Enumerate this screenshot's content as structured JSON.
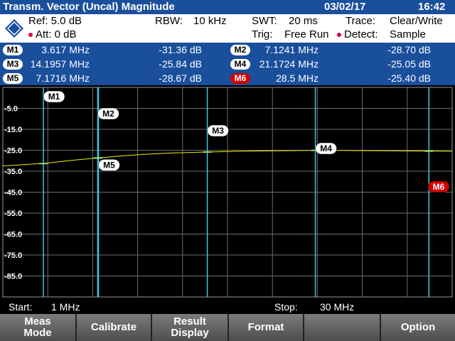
{
  "title": "Transm. Vector (Uncal) Magnitude",
  "date": "03/02/17",
  "time": "16:42",
  "info": {
    "ref": "Ref:  5.0 dB",
    "att": "Att:  0 dB",
    "rbw_label": "RBW:",
    "rbw_value": "10 kHz",
    "swt_label": "SWT:",
    "swt_value": "20 ms",
    "trig_label": "Trig:",
    "trig_value": "Free Run",
    "trace_label": "Trace:",
    "trace_value": "Clear/Write",
    "detect_label": "Detect:",
    "detect_value": "Sample",
    "status_dot_color": "#e0003c"
  },
  "markers": [
    {
      "label": "M1",
      "freq": "3.617 MHz",
      "level": "-31.36 dB",
      "x_mhz": 3.617
    },
    {
      "label": "M2",
      "freq": "7.1241 MHz",
      "level": "-28.70 dB",
      "x_mhz": 7.1241
    },
    {
      "label": "M3",
      "freq": "14.1957 MHz",
      "level": "-25.84 dB",
      "x_mhz": 14.1957
    },
    {
      "label": "M4",
      "freq": "21.1724 MHz",
      "level": "-25.05 dB",
      "x_mhz": 21.1724
    },
    {
      "label": "M5",
      "freq": "7.1716 MHz",
      "level": "-28.67 dB",
      "x_mhz": 7.1716
    },
    {
      "label": "M6",
      "freq": "28.5 MHz",
      "level": "-25.40 dB",
      "x_mhz": 28.5,
      "active": true
    }
  ],
  "chart_data": {
    "type": "line",
    "x_range_mhz": [
      1,
      30
    ],
    "ylim": [
      -95,
      5
    ],
    "y_ticks": [
      "-5.0",
      "-15.0",
      "-25.0",
      "-35.0",
      "-45.0",
      "-55.0",
      "-65.0",
      "-75.0",
      "-85.0"
    ],
    "y_tick_values": [
      -5,
      -15,
      -25,
      -35,
      -45,
      -55,
      -65,
      -75,
      -85
    ],
    "grid": true,
    "trace_color": "#f0f000",
    "trace": [
      [
        1,
        -32.5
      ],
      [
        2,
        -32.0
      ],
      [
        3,
        -31.5
      ],
      [
        3.617,
        -31.36
      ],
      [
        5,
        -30.2
      ],
      [
        6,
        -29.4
      ],
      [
        7.1241,
        -28.7
      ],
      [
        8.5,
        -27.8
      ],
      [
        10,
        -27.0
      ],
      [
        12,
        -26.3
      ],
      [
        14.1957,
        -25.84
      ],
      [
        16,
        -25.5
      ],
      [
        18,
        -25.3
      ],
      [
        21.1724,
        -25.05
      ],
      [
        23,
        -25.1
      ],
      [
        25,
        -25.2
      ],
      [
        27,
        -25.3
      ],
      [
        28.5,
        -25.4
      ],
      [
        30,
        -25.5
      ]
    ],
    "marker_line_color": "#40c8e8"
  },
  "footer": {
    "start_label": "Start:",
    "start_value": "1 MHz",
    "stop_label": "Stop:",
    "stop_value": "30 MHz"
  },
  "softkeys": [
    {
      "label": "Meas\nMode"
    },
    {
      "label": "Calibrate"
    },
    {
      "label": "Result\nDisplay"
    },
    {
      "label": "Format"
    },
    {
      "label": ""
    },
    {
      "label": "Option"
    }
  ]
}
